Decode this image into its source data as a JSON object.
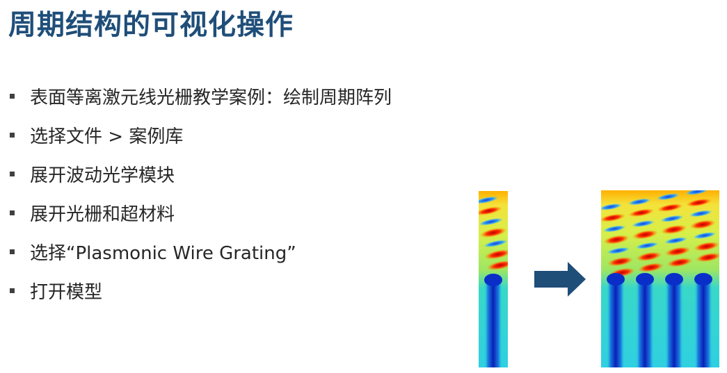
{
  "slide": {
    "title": "周期结构的可视化操作",
    "bullets": [
      "表面等离激元线光栅教学案例：绘制周期阵列",
      "选择文件 > 案例库",
      "展开波动光学模块",
      "展开光栅和超材料",
      "选择“Plasmonic Wire Grating”",
      "打开模型"
    ]
  },
  "colors": {
    "title": "#1f4e79",
    "text": "#262626",
    "bullet_marker": "#404040",
    "arrow": "#1f4e79"
  },
  "figures": {
    "single_period": "field-plot-single-unit-cell",
    "periodic_array": "field-plot-periodic-array",
    "arrow": "right-arrow-icon"
  }
}
